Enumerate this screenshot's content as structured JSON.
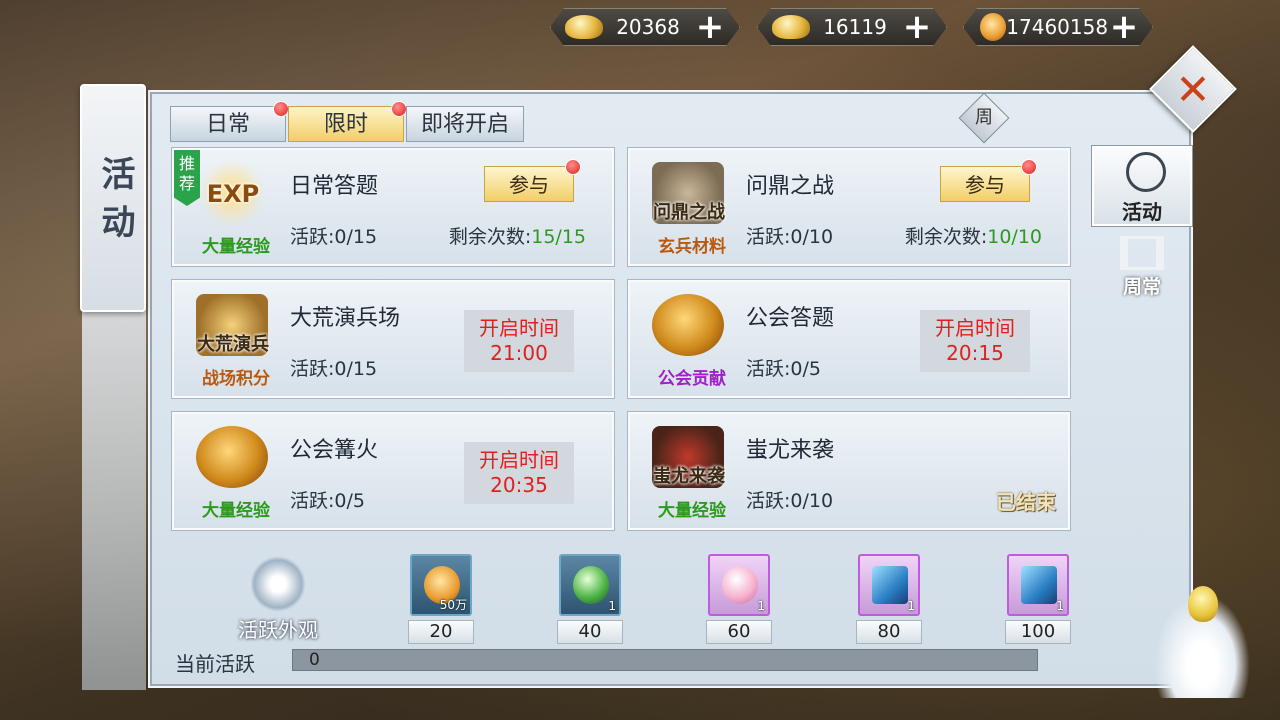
{
  "currencies": [
    {
      "icon": "locked-gold-ingot-icon",
      "value": "20368"
    },
    {
      "icon": "gold-ingot-icon",
      "value": "16119"
    },
    {
      "icon": "copper-coin-icon",
      "value": "17460158"
    }
  ],
  "plus_symbol": "+",
  "title": "活动",
  "tabs": [
    {
      "label": "日常",
      "dot": true
    },
    {
      "label": "限时",
      "dot": true,
      "active": true
    },
    {
      "label": "即将开启",
      "dot": false
    }
  ],
  "week_badge": "周",
  "recommend_badge": "推荐",
  "activities": [
    {
      "name": "日常答题",
      "icon_label": "EXP",
      "caption": "大量经验",
      "caption_color": "#2c9a1e",
      "active": "活跃:0/15",
      "remain_label": "剩余次数:",
      "remain_value": "15/15",
      "button": "参与"
    },
    {
      "name": "问鼎之战",
      "icon_label": "问鼎之战",
      "caption": "玄兵材料",
      "caption_color": "#b85a10",
      "active": "活跃:0/10",
      "remain_label": "剩余次数:",
      "remain_value": "10/10",
      "button": "参与"
    },
    {
      "name": "大荒演兵场",
      "icon_label": "大荒演兵",
      "caption": "战场积分",
      "caption_color": "#b85a10",
      "active": "活跃:0/15",
      "time_label": "开启时间",
      "time": "21:00"
    },
    {
      "name": "公会答题",
      "icon_label": "",
      "caption": "公会贡献",
      "caption_color": "#a020c8",
      "active": "活跃:0/5",
      "time_label": "开启时间",
      "time": "20:15"
    },
    {
      "name": "公会篝火",
      "icon_label": "",
      "caption": "大量经验",
      "caption_color": "#2c9a1e",
      "active": "活跃:0/5",
      "time_label": "开启时间",
      "time": "20:35"
    },
    {
      "name": "蚩尤来袭",
      "icon_label": "蚩尤来袭",
      "caption": "大量经验",
      "caption_color": "#2c9a1e",
      "active": "活跃:0/10",
      "status": "已结束"
    }
  ],
  "nav": {
    "activity": "活动",
    "weekly": "周常"
  },
  "outfit_label": "活跃外观",
  "rewards": [
    {
      "milestone": "20",
      "qty": "50万",
      "icon": "copper-coin-icon"
    },
    {
      "milestone": "40",
      "qty": "1",
      "icon": "jade-orb-icon"
    },
    {
      "milestone": "60",
      "qty": "1",
      "icon": "pink-pearl-icon"
    },
    {
      "milestone": "80",
      "qty": "1",
      "icon": "blue-token-icon"
    },
    {
      "milestone": "100",
      "qty": "1",
      "icon": "blue-token-icon"
    }
  ],
  "current_active_label": "当前活跃",
  "current_active_value": "0",
  "current_active_fraction": 0
}
